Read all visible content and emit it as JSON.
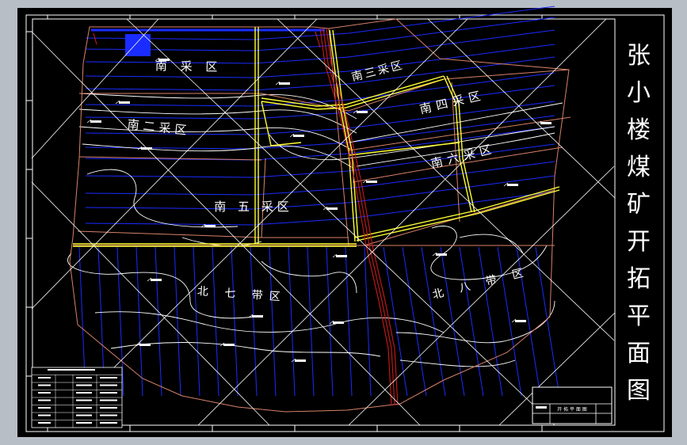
{
  "drawing": {
    "title_chars": [
      "张",
      "小",
      "楼",
      "煤",
      "矿",
      "开",
      "拓",
      "平",
      "面",
      "图"
    ],
    "zones": [
      {
        "id": "nan-cai",
        "text": "南 采 区"
      },
      {
        "id": "nan-er",
        "text": "南二采区"
      },
      {
        "id": "nan-san",
        "text": "南三采区"
      },
      {
        "id": "nan-si",
        "text": "南四采区"
      },
      {
        "id": "nan-liu",
        "text": "南六采区"
      },
      {
        "id": "nan-wu",
        "text": "南 五 采区"
      },
      {
        "id": "bei-qi",
        "text": "北 七 带区"
      },
      {
        "id": "bei-ba",
        "text": "北 八 带 区"
      }
    ],
    "titleblock_label": "开 拓 平 面 图",
    "colors": {
      "background": "#000000",
      "frame": "#ffffff",
      "seam_lines": "#1a2cff",
      "contours": "#ffffff",
      "boundary": "#d8826a",
      "roadway": "#ffff33",
      "fault": "#cc1a1a"
    }
  }
}
